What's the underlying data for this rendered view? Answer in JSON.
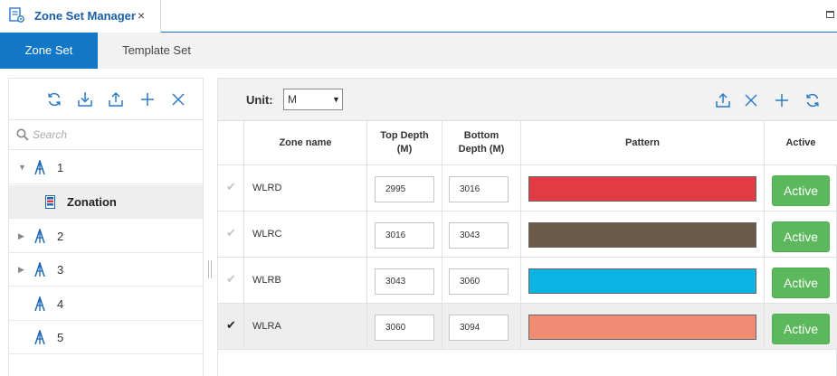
{
  "window": {
    "tab_title": "Zone Set Manager",
    "close_glyph": "×"
  },
  "subtabs": [
    {
      "label": "Zone Set",
      "active": true
    },
    {
      "label": "Template Set",
      "active": false
    }
  ],
  "left_toolbar": {
    "icons": [
      "refresh-icon",
      "download-icon",
      "upload-icon",
      "add-icon",
      "close-icon"
    ]
  },
  "search": {
    "placeholder": "Search",
    "value": ""
  },
  "tree": [
    {
      "label": "1",
      "expanded": true,
      "icon": "rig-icon"
    },
    {
      "label": "Zonation",
      "selected": true,
      "icon": "zonation-icon"
    },
    {
      "label": "2",
      "expanded": false,
      "icon": "rig-icon"
    },
    {
      "label": "3",
      "expanded": false,
      "icon": "rig-icon"
    },
    {
      "label": "4",
      "icon": "rig-icon"
    },
    {
      "label": "5",
      "icon": "rig-icon"
    }
  ],
  "right_toolbar": {
    "unit_label": "Unit:",
    "unit_value": "M",
    "icons": [
      "upload-icon",
      "close-icon",
      "add-icon",
      "refresh-icon"
    ]
  },
  "table": {
    "headers": {
      "zone_name": "Zone name",
      "top_depth_1": "Top Depth",
      "top_depth_2": "(M)",
      "bottom_depth_1": "Bottom",
      "bottom_depth_2": "Depth (M)",
      "pattern": "Pattern",
      "active": "Active"
    },
    "rows": [
      {
        "name": "WLRD",
        "top": "2995",
        "bottom": "3016",
        "color": "#e13c44",
        "active_label": "Active",
        "checked": false
      },
      {
        "name": "WLRC",
        "top": "3016",
        "bottom": "3043",
        "color": "#6b5a48",
        "active_label": "Active",
        "checked": false
      },
      {
        "name": "WLRB",
        "top": "3043",
        "bottom": "3060",
        "color": "#0cb4e4",
        "active_label": "Active",
        "checked": false
      },
      {
        "name": "WLRA",
        "top": "3060",
        "bottom": "3094",
        "color": "#f08c74",
        "active_label": "Active",
        "checked": true
      }
    ]
  },
  "colors": {
    "accent": "#1177c6",
    "icon_blue": "#2b7bc4",
    "active_green": "#5cb85c"
  }
}
